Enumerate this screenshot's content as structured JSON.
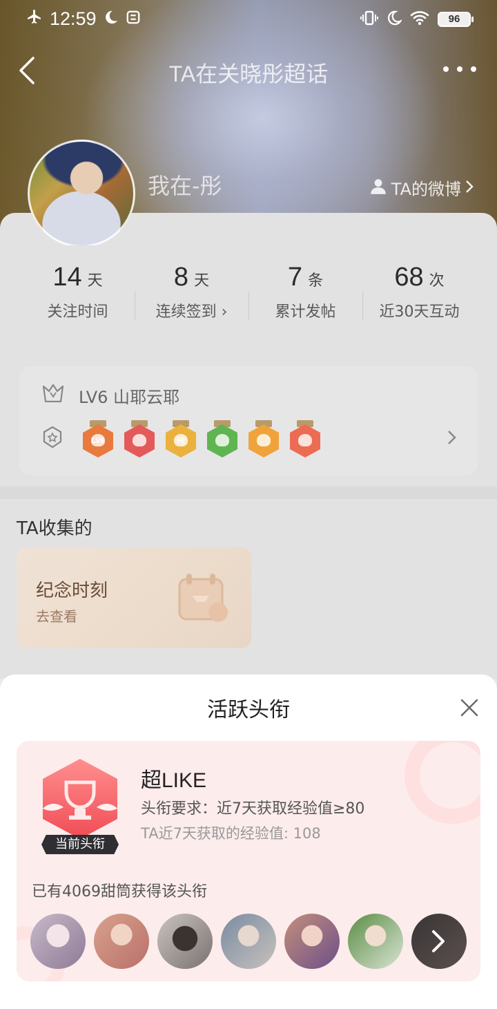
{
  "status_bar": {
    "time": "12:59",
    "battery": "96"
  },
  "header": {
    "title": "TA在关晓彤超话"
  },
  "profile": {
    "name": "我在-彤",
    "weibo_link": "TA的微博"
  },
  "stats": [
    {
      "value": "14",
      "unit": "天",
      "label": "关注时间"
    },
    {
      "value": "8",
      "unit": "天",
      "label": "连续签到 ›"
    },
    {
      "value": "7",
      "unit": "条",
      "label": "累计发帖"
    },
    {
      "value": "68",
      "unit": "次",
      "label": "近30天互动"
    }
  ],
  "level": {
    "text": "LV6 山耶云耶"
  },
  "medals": [
    {
      "name": "lv6-medal",
      "color": "#e97a3d",
      "text": "LV6"
    },
    {
      "name": "trophy-medal",
      "color": "#e45a5a",
      "text": ""
    },
    {
      "name": "hi-medal",
      "color": "#ebb13c",
      "text": "Hi"
    },
    {
      "name": "hand-medal",
      "color": "#5fb551",
      "text": ""
    },
    {
      "name": "laugh-medal",
      "color": "#f0a33b",
      "text": ""
    },
    {
      "name": "rock-medal",
      "color": "#ec6b53",
      "text": ""
    }
  ],
  "collect": {
    "title": "TA收集的",
    "card_title": "纪念时刻",
    "card_sub": "去查看"
  },
  "sheet": {
    "title": "活跃头衔",
    "badge_tag": "当前头衔",
    "title_name": "超LIKE",
    "requirement": "头衔要求：近7天获取经验值≥80",
    "experience": "TA近7天获取的经验值: 108",
    "owners": "已有4069甜筒获得该头衔"
  },
  "colors": {
    "accent": "#f04d55",
    "card_bg": "#fdecec"
  }
}
